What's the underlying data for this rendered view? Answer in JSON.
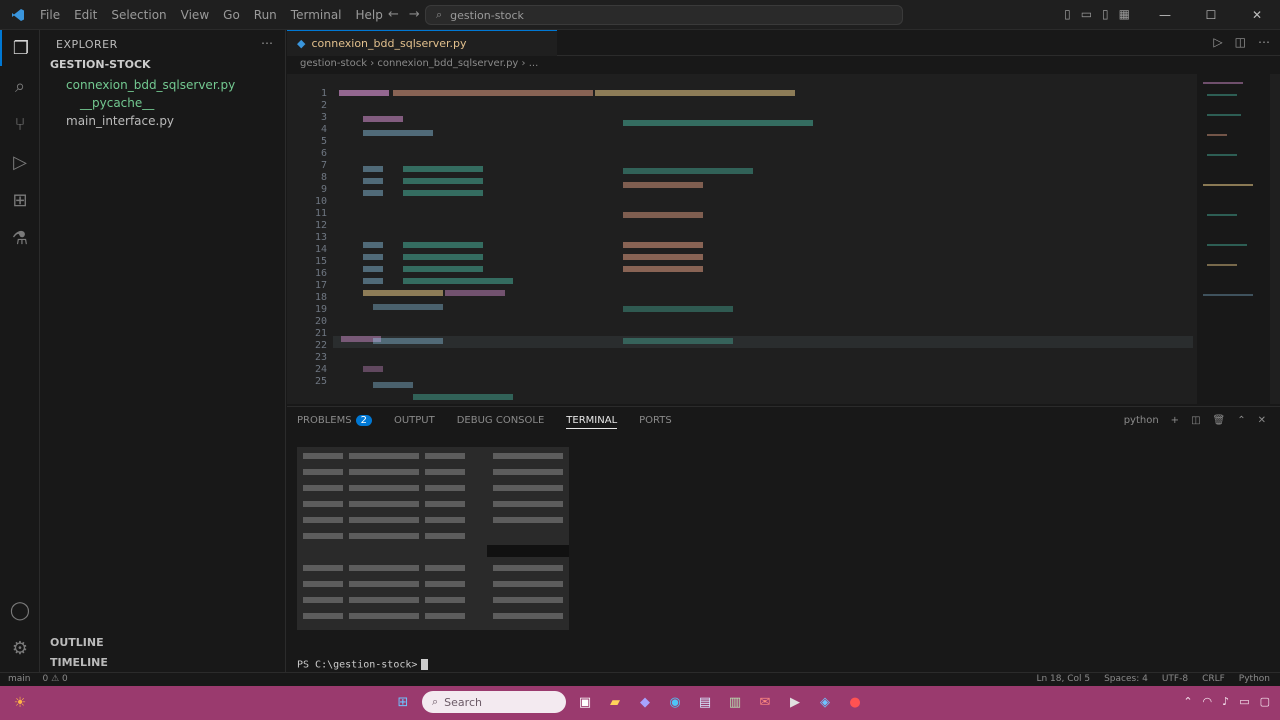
{
  "window": {
    "menu": [
      "File",
      "Edit",
      "Selection",
      "View",
      "Go",
      "Run",
      "Terminal",
      "Help"
    ],
    "command_center": "gestion-stock",
    "controls": {
      "minimize": "—",
      "maximize": "☐",
      "close": "✕"
    }
  },
  "activity_bar": {
    "items": [
      "explorer",
      "search",
      "source-control",
      "run-debug",
      "extensions",
      "testing"
    ]
  },
  "sidebar": {
    "title": "EXPLORER",
    "folder": "GESTION-STOCK",
    "items": [
      "connexion_bdd_sqlserver.py",
      "__pycache__",
      "main_interface.py"
    ],
    "outline_label": "OUTLINE",
    "timeline_label": "TIMELINE"
  },
  "editor": {
    "tab_label": "connexion_bdd_sqlserver.py",
    "breadcrumb": "gestion-stock › connexion_bdd_sqlserver.py › ...",
    "lines": [
      "1",
      "2",
      "3",
      "4",
      "5",
      "6",
      "7",
      "8",
      "9",
      "10",
      "11",
      "12",
      "13",
      "14",
      "15",
      "16",
      "17",
      "18",
      "19",
      "20",
      "21",
      "22",
      "23",
      "24",
      "25"
    ]
  },
  "panel": {
    "tabs": [
      "PROBLEMS",
      "OUTPUT",
      "DEBUG CONSOLE",
      "TERMINAL",
      "PORTS"
    ],
    "problems_count": "2",
    "actions": "python",
    "prompt": "PS C:\\gestion-stock>"
  },
  "statusbar": {
    "left": [
      "main",
      "0 ⚠ 0"
    ],
    "right": [
      "Ln 18, Col 5",
      "Spaces: 4",
      "UTF-8",
      "CRLF",
      "Python"
    ]
  },
  "taskbar": {
    "search_placeholder": "Search"
  },
  "colors": {
    "accent": "#0078d4",
    "taskbar": "#9a3a6e",
    "keyword": "#c586c0",
    "string": "#ce9178",
    "function": "#dcdcaa",
    "variable": "#4ec9b0"
  }
}
